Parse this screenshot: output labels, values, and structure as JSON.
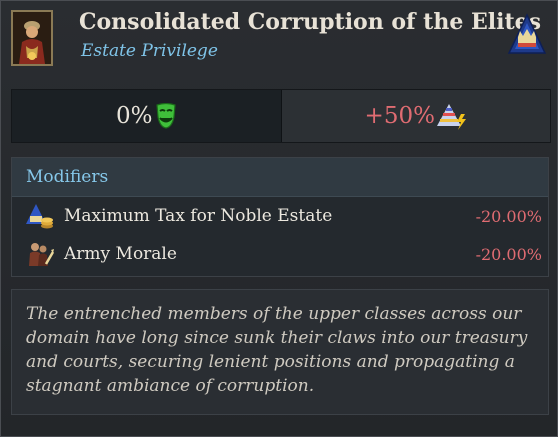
{
  "header": {
    "title": "Consolidated Corruption of the Elites",
    "subtitle": "Estate Privilege",
    "portrait_icon": "noble-portrait-icon",
    "estate_icon": "estate-crown-icon"
  },
  "stats": {
    "satisfaction": "0%",
    "satisfaction_icon": "happy-mask-icon",
    "power": "+50%",
    "power_icon": "estate-power-pyramid-icon"
  },
  "modifiers": {
    "header": "Modifiers",
    "items": [
      {
        "label": "Maximum Tax for Noble Estate",
        "value": "-20.00%",
        "icon": "noble-tax-icon"
      },
      {
        "label": "Army Morale",
        "value": "-20.00%",
        "icon": "army-morale-icon"
      }
    ]
  },
  "description": "The entrenched members of the upper classes across our domain have long since sunk their claws into our treasury and courts, securing lenient positions and propagating a stagnant ambiance of corruption.",
  "colors": {
    "accent_blue": "#7fc4e8",
    "negative_red": "#e06c72",
    "mask_green": "#3fbf3a"
  }
}
